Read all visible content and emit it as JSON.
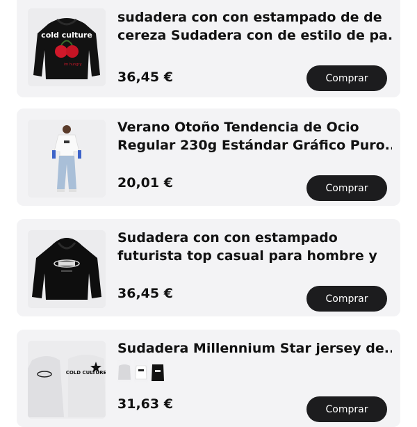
{
  "products": [
    {
      "title_line1": "sudadera con con estampado de de",
      "title_line2": "cereza Sudadera con de estilo de pa...",
      "price": "36,45 €",
      "buy_label": "Comprar",
      "image_icon": "black-hoodie-cherry-print",
      "print_text": "cold culture"
    },
    {
      "title_line1": "Verano Otoño Tendencia de Ocio",
      "title_line2": "Regular 230g Estándar Gráfico Puro...",
      "price": "20,01 €",
      "buy_label": "Comprar",
      "image_icon": "model-white-tee-jeans"
    },
    {
      "title_line1": "Sudadera con con estampado",
      "title_line2": "futurista top casual para hombre y",
      "price": "36,45 €",
      "buy_label": "Comprar",
      "image_icon": "black-hoodie-futuristic-logo"
    },
    {
      "title_line1": "Sudadera Millennium Star jersey de...",
      "title_line2": "",
      "price": "31,63 €",
      "buy_label": "Comprar",
      "image_icon": "grey-sweatshirt-star-print",
      "print_text": "COLD CULTURE",
      "variants": [
        "grey-sweatshirt-variant",
        "white-tee-variant",
        "black-tee-variant"
      ]
    }
  ],
  "colors": {
    "card_bg": "#f3f3f5",
    "button_bg": "#1c1c1e",
    "button_text": "#ffffff",
    "text": "#111111"
  }
}
